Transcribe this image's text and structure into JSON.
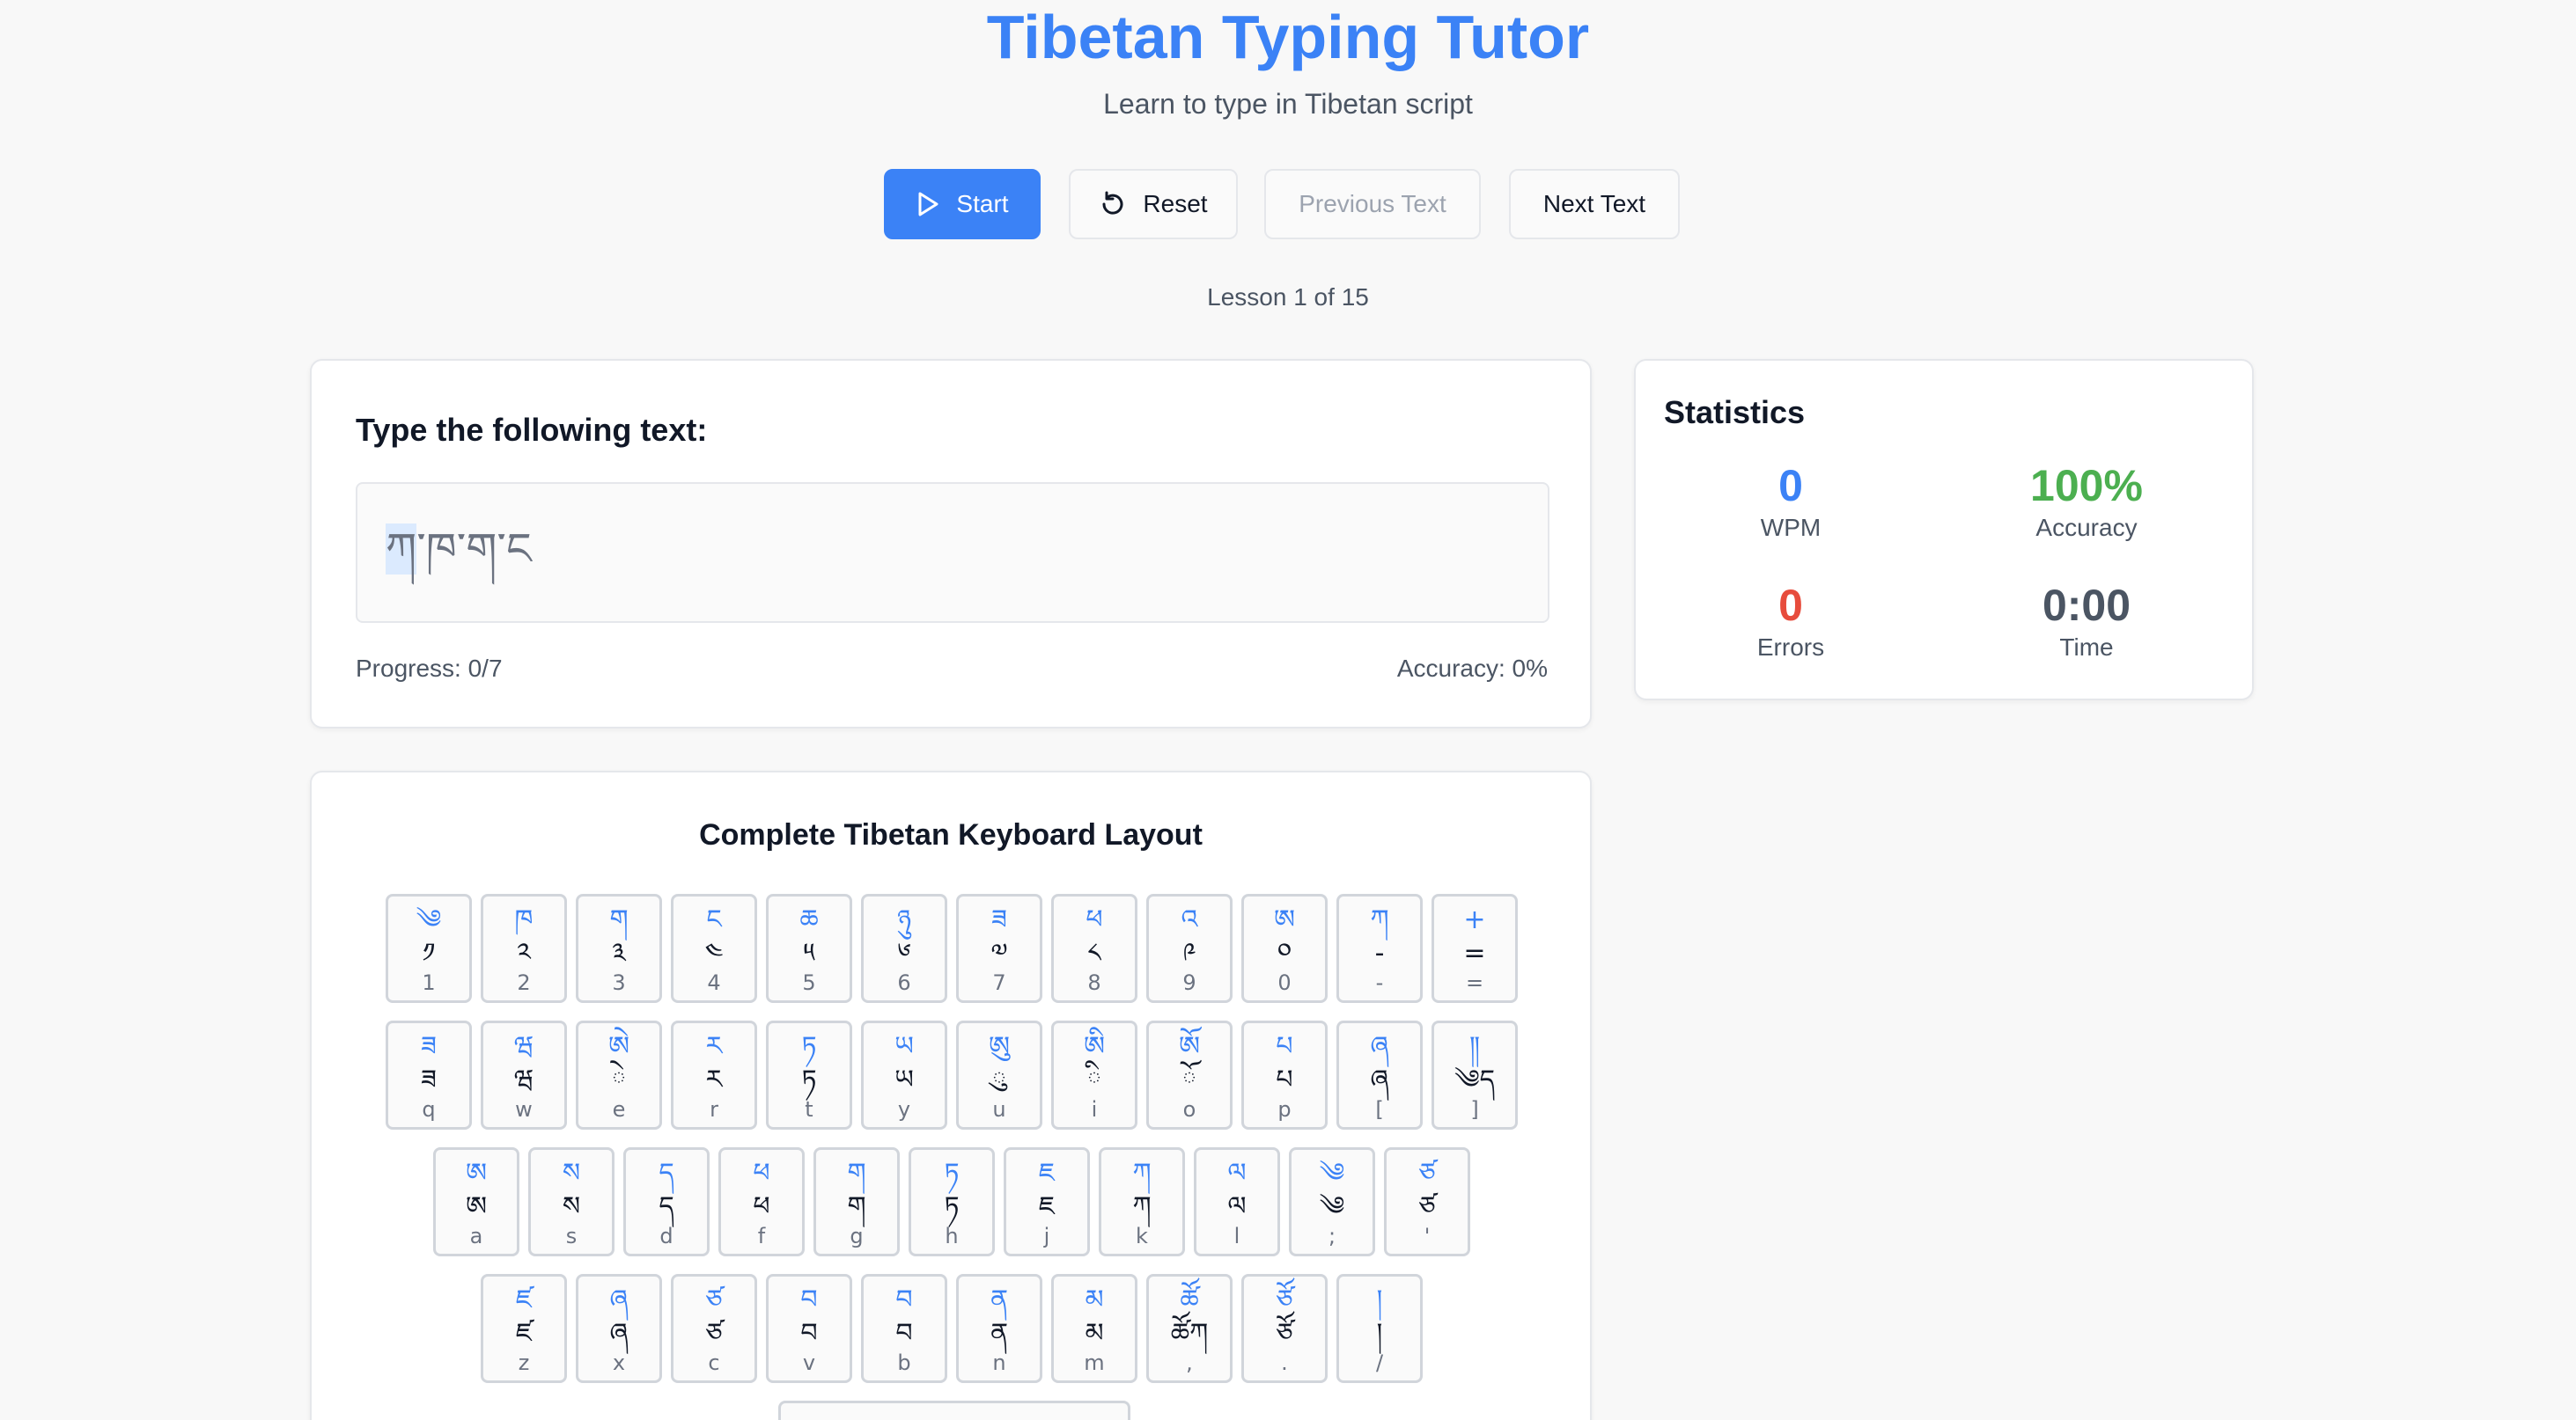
{
  "header": {
    "title": "Tibetan Typing Tutor",
    "subtitle": "Learn to type in Tibetan script"
  },
  "controls": {
    "start_label": "Start",
    "reset_label": "Reset",
    "previous_label": "Previous Text",
    "next_label": "Next Text"
  },
  "lesson_text": "Lesson 1 of 15",
  "practice": {
    "heading": "Type the following text:",
    "current_char": "ཀ",
    "remaining_text": "་ཁ་ག་ང",
    "progress": "Progress: 0/7",
    "accuracy": "Accuracy: 0%"
  },
  "statistics": {
    "heading": "Statistics",
    "wpm_value": "0",
    "wpm_label": "WPM",
    "accuracy_value": "100%",
    "accuracy_label": "Accuracy",
    "errors_value": "0",
    "errors_label": "Errors",
    "time_value": "0:00",
    "time_label": "Time"
  },
  "colors": {
    "accent": "#3b82f6",
    "success": "#4caf50",
    "error": "#e74c3c",
    "neutral": "#4b5563"
  },
  "keyboard": {
    "heading": "Complete Tibetan Keyboard Layout",
    "rows": [
      [
        {
          "shift": "༄",
          "main": "༡",
          "key": "1"
        },
        {
          "shift": "ཁ",
          "main": "༢",
          "key": "2"
        },
        {
          "shift": "ག",
          "main": "༣",
          "key": "3"
        },
        {
          "shift": "ང",
          "main": "༤",
          "key": "4"
        },
        {
          "shift": "ཆ",
          "main": "༥",
          "key": "5"
        },
        {
          "shift": "ཉུ",
          "main": "༦",
          "key": "6"
        },
        {
          "shift": "ཟ",
          "main": "༧",
          "key": "7"
        },
        {
          "shift": "ཕ",
          "main": "༨",
          "key": "8"
        },
        {
          "shift": "འ",
          "main": "༩",
          "key": "9"
        },
        {
          "shift": "ཨ",
          "main": "༠",
          "key": "0"
        },
        {
          "shift": "ཀ",
          "main": "-",
          "key": "-"
        },
        {
          "shift": "+",
          "main": "=",
          "key": "="
        }
      ],
      [
        {
          "shift": "ཟ",
          "main": "ཟ",
          "key": "q"
        },
        {
          "shift": "ཝ",
          "main": "ཝ",
          "key": "w"
        },
        {
          "shift": "ཨེ",
          "main": "ེ",
          "key": "e"
        },
        {
          "shift": "ར",
          "main": "ར",
          "key": "r"
        },
        {
          "shift": "ཏ",
          "main": "ཏ",
          "key": "t"
        },
        {
          "shift": "ཡ",
          "main": "ཡ",
          "key": "y"
        },
        {
          "shift": "ཨུ",
          "main": "ུ",
          "key": "u"
        },
        {
          "shift": "ཨི",
          "main": "ི",
          "key": "i"
        },
        {
          "shift": "ཨོ",
          "main": "ོ",
          "key": "o"
        },
        {
          "shift": "པ",
          "main": "པ",
          "key": "p"
        },
        {
          "shift": "ཞ",
          "main": "ཞ",
          "key": "["
        },
        {
          "shift": "༎",
          "main": "༄ད",
          "key": "]"
        }
      ],
      [
        {
          "shift": "ཨ",
          "main": "ཨ",
          "key": "a"
        },
        {
          "shift": "ས",
          "main": "ས",
          "key": "s"
        },
        {
          "shift": "ད",
          "main": "ད",
          "key": "d"
        },
        {
          "shift": "ཕ",
          "main": "ཕ",
          "key": "f"
        },
        {
          "shift": "ག",
          "main": "ག",
          "key": "g"
        },
        {
          "shift": "ཏ",
          "main": "ཏ",
          "key": "h"
        },
        {
          "shift": "ཇ",
          "main": "ཇ",
          "key": "j"
        },
        {
          "shift": "ཀ",
          "main": "ཀ",
          "key": "k"
        },
        {
          "shift": "ལ",
          "main": "ལ",
          "key": "l"
        },
        {
          "shift": "༄",
          "main": "༄",
          "key": ";"
        },
        {
          "shift": "ཙ",
          "main": "ཙ",
          "key": "'"
        }
      ],
      [
        {
          "shift": "ཛ",
          "main": "ཛ",
          "key": "z"
        },
        {
          "shift": "ཞ",
          "main": "ཞ",
          "key": "x"
        },
        {
          "shift": "ཙ",
          "main": "ཙ",
          "key": "c"
        },
        {
          "shift": "བ",
          "main": "བ",
          "key": "v"
        },
        {
          "shift": "བ",
          "main": "བ",
          "key": "b"
        },
        {
          "shift": "ན",
          "main": "ན",
          "key": "n"
        },
        {
          "shift": "མ",
          "main": "མ",
          "key": "m"
        },
        {
          "shift": "ཚོ",
          "main": "ཚོཀ",
          "key": ","
        },
        {
          "shift": "ཙོ",
          "main": "ཙོ",
          "key": "."
        },
        {
          "shift": "།",
          "main": "།",
          "key": "/"
        }
      ]
    ]
  }
}
